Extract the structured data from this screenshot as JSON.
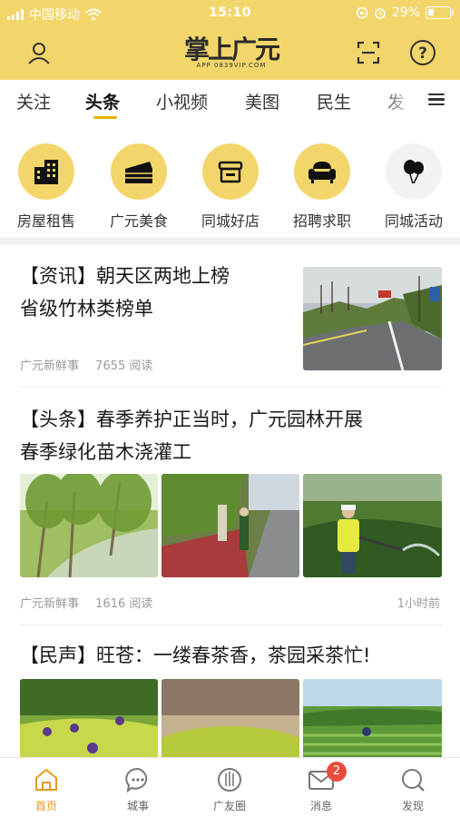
{
  "status_bar": {
    "carrier": "中国移动",
    "time": "15:10",
    "battery_text": "29%",
    "battery_level": 0.29
  },
  "header": {
    "logo_text": "掌上广元",
    "logo_sub": "APP 0839VIP.COM",
    "left_icon": "user-icon",
    "right_icons": [
      "scan-icon",
      "help-icon"
    ]
  },
  "tabs": {
    "items": [
      "关注",
      "头条",
      "小视频",
      "美图",
      "民生",
      "发"
    ],
    "active_index": 1,
    "menu_icon": "hamburger-icon"
  },
  "categories": [
    {
      "label": "房屋租售",
      "icon": "building-icon"
    },
    {
      "label": "广元美食",
      "icon": "cake-icon"
    },
    {
      "label": "同城好店",
      "icon": "shop-icon"
    },
    {
      "label": "招聘求职",
      "icon": "sofa-icon"
    },
    {
      "label": "同城活动",
      "icon": "balloons-icon"
    }
  ],
  "feed": [
    {
      "title_line1": "【资讯】朝天区两地上榜",
      "title_line2": "省级竹林类榜单",
      "source": "广元新鲜事",
      "reads": "7655 阅读"
    },
    {
      "title_line1": "【头条】春季养护正当时，广元园林开展",
      "title_line2": "春季绿化苗木浇灌工",
      "source": "广元新鲜事",
      "reads": "1616 阅读",
      "time": "1小时前"
    },
    {
      "title_line1": "【民声】旺苍：一缕春茶香，茶园采茶忙!"
    }
  ],
  "bottom_nav": [
    {
      "label": "首页",
      "icon": "home-icon",
      "active": true
    },
    {
      "label": "城事",
      "icon": "chat-icon"
    },
    {
      "label": "广友圈",
      "icon": "circle-icon"
    },
    {
      "label": "消息",
      "icon": "mail-icon",
      "badge": "2"
    },
    {
      "label": "发现",
      "icon": "discover-icon"
    }
  ],
  "colors": {
    "brand_yellow": "#f3d66b",
    "accent_orange": "#e59a1f",
    "badge_red": "#e74c3c"
  }
}
